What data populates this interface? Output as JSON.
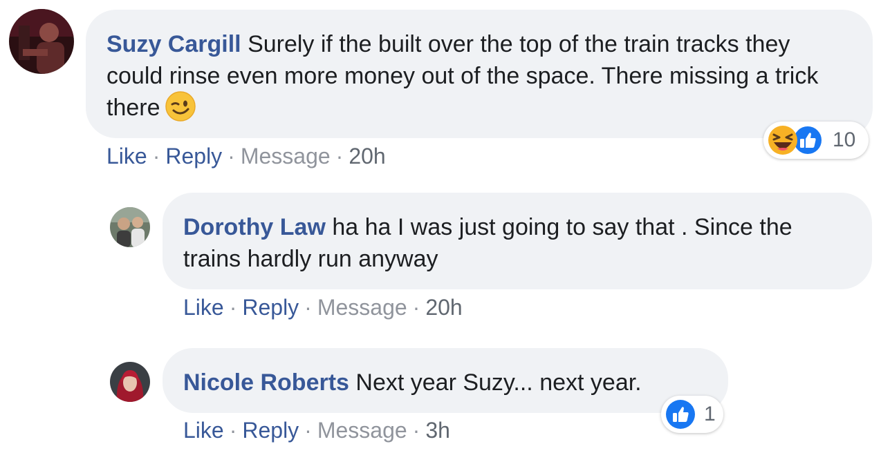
{
  "comments": [
    {
      "author": "Suzy Cargill",
      "text": "Surely if the built over the top of the train tracks they could rinse even more money out of the space. There missing a trick there",
      "emoji": "winking-face",
      "actions": {
        "like": "Like",
        "reply": "Reply",
        "message": "Message",
        "time": "20h"
      },
      "reactions": {
        "icons": [
          "haha-icon",
          "like-icon"
        ],
        "count": "10"
      }
    },
    {
      "author": "Dorothy Law",
      "text": "ha ha I was just going to say that . Since the trains hardly run anyway",
      "actions": {
        "like": "Like",
        "reply": "Reply",
        "message": "Message",
        "time": "20h"
      }
    },
    {
      "author": "Nicole Roberts",
      "text": "Next year Suzy... next year.",
      "actions": {
        "like": "Like",
        "reply": "Reply",
        "message": "Message",
        "time": "3h"
      },
      "reactions": {
        "icons": [
          "like-icon"
        ],
        "count": "1"
      }
    }
  ],
  "separator": "·",
  "colors": {
    "author_link": "#385898",
    "bubble_bg": "#f0f2f5",
    "muted_text": "#90949c",
    "like_blue": "#1877f2",
    "haha_yellow": "#f7b125"
  }
}
